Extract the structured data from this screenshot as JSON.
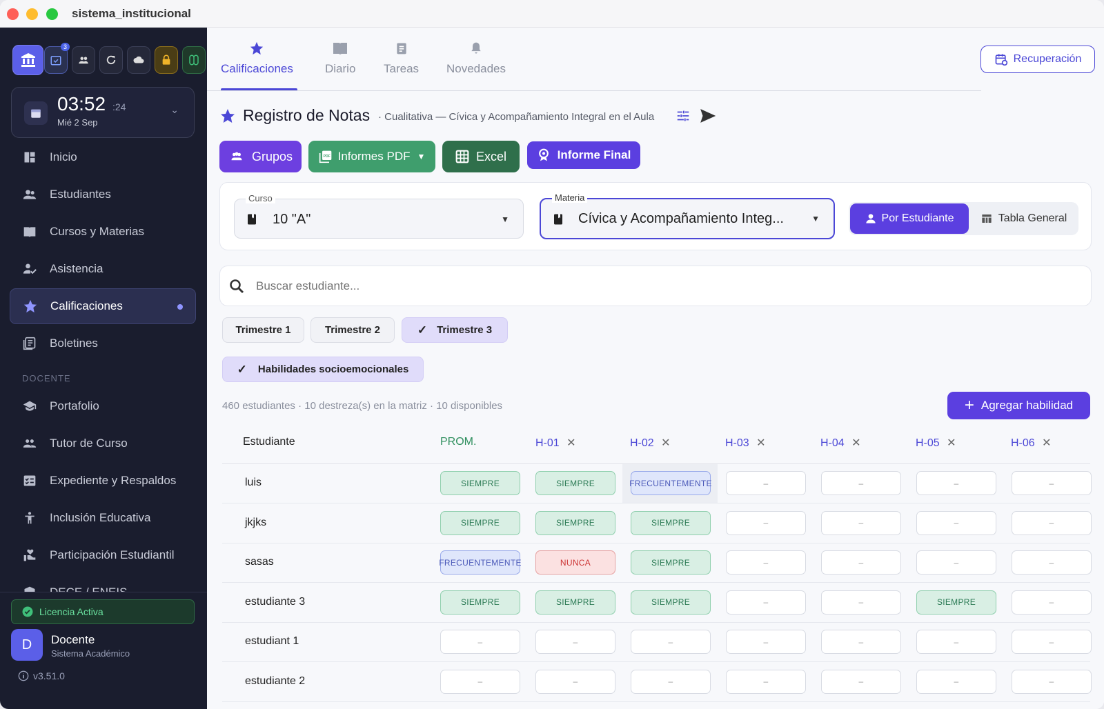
{
  "window": {
    "title": "sistema_institucional"
  },
  "sidebar": {
    "badge_count": "3",
    "clock": {
      "time": "03:52",
      "seconds": ":24",
      "date": "Mié 2 Sep"
    },
    "items": [
      {
        "label": "Inicio"
      },
      {
        "label": "Estudiantes"
      },
      {
        "label": "Cursos y Materias"
      },
      {
        "label": "Asistencia"
      },
      {
        "label": "Calificaciones"
      },
      {
        "label": "Boletines"
      }
    ],
    "section_label": "DOCENTE",
    "docente_items": [
      {
        "label": "Portafolio"
      },
      {
        "label": "Tutor de Curso"
      },
      {
        "label": "Expediente y Respaldos"
      },
      {
        "label": "Inclusión Educativa"
      },
      {
        "label": "Participación Estudiantil"
      },
      {
        "label": "DECE / ENEIS"
      }
    ],
    "license": "Licencia Activa",
    "user": {
      "initial": "D",
      "name": "Docente",
      "role": "Sistema Académico"
    },
    "version": "v3.51.0"
  },
  "tabs": [
    {
      "label": "Calificaciones"
    },
    {
      "label": "Diario"
    },
    {
      "label": "Tareas"
    },
    {
      "label": "Novedades"
    }
  ],
  "recuperacion": "Recuperación",
  "header": {
    "title": "Registro de Notas",
    "subtitle": "· Cualitativa — Cívica y Acompañamiento Integral en el Aula"
  },
  "actions": {
    "grupos": "Grupos",
    "pdf": "Informes PDF",
    "excel": "Excel",
    "final": "Informe Final"
  },
  "filters": {
    "curso_label": "Curso",
    "curso_value": "10 \"A\"",
    "materia_label": "Materia",
    "materia_value": "Cívica y Acompañamiento Integ...",
    "view_student": "Por Estudiante",
    "view_table": "Tabla General"
  },
  "search": {
    "placeholder": "Buscar estudiante..."
  },
  "trimestres": [
    {
      "label": "Trimestre 1"
    },
    {
      "label": "Trimestre 2"
    },
    {
      "label": "Trimestre 3"
    }
  ],
  "habilidades": "Habilidades socioemocionales",
  "summary": "460 estudiantes · 10 destreza(s) en la matriz · 10 disponibles",
  "add_skill": "Agregar habilidad",
  "table": {
    "headers": {
      "student": "Estudiante",
      "prom": "PROM.",
      "h": [
        "H-01",
        "H-02",
        "H-03",
        "H-04",
        "H-05",
        "H-06"
      ]
    },
    "rows": [
      {
        "name": "luis",
        "cells": [
          "SIEMPRE",
          "SIEMPRE",
          "FRECUENTEMENTE",
          "–",
          "–",
          "–",
          "–"
        ]
      },
      {
        "name": "jkjks",
        "cells": [
          "SIEMPRE",
          "SIEMPRE",
          "SIEMPRE",
          "–",
          "–",
          "–",
          "–"
        ]
      },
      {
        "name": "sasas",
        "cells": [
          "FRECUENTEMENTE",
          "NUNCA",
          "SIEMPRE",
          "–",
          "–",
          "–",
          "–"
        ]
      },
      {
        "name": "estudiante 3",
        "cells": [
          "SIEMPRE",
          "SIEMPRE",
          "SIEMPRE",
          "–",
          "–",
          "SIEMPRE",
          "–"
        ]
      },
      {
        "name": "estudiant 1",
        "cells": [
          "–",
          "–",
          "–",
          "–",
          "–",
          "–",
          "–"
        ]
      },
      {
        "name": "estudiante 2",
        "cells": [
          "–",
          "–",
          "–",
          "–",
          "–",
          "–",
          "–"
        ]
      }
    ]
  },
  "colors": {
    "accent": "#5b3fe0",
    "green": "#3f9e6d",
    "darkgreen": "#2f6f4b",
    "sidebar": "#1a1d2e"
  }
}
